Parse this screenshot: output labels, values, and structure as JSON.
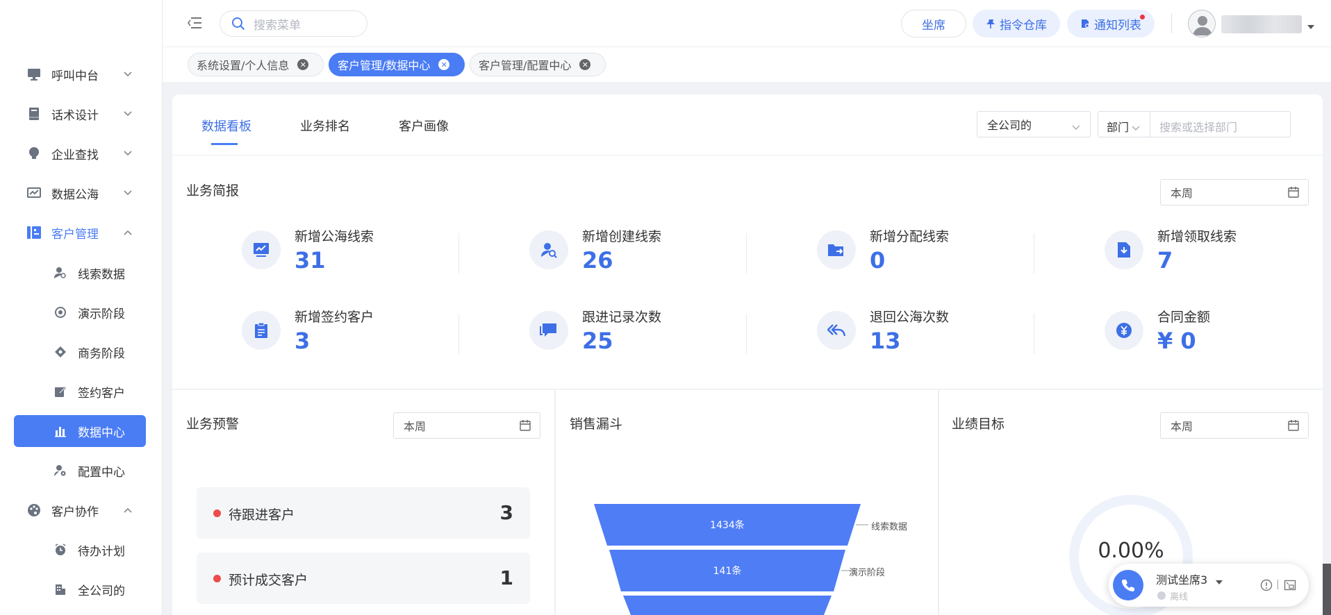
{
  "sidebar": {
    "items": [
      {
        "label": "呼叫中台",
        "icon": "monitor-icon",
        "chevron": "down"
      },
      {
        "label": "话术设计",
        "icon": "book-icon",
        "chevron": "down"
      },
      {
        "label": "企业查找",
        "icon": "lightbulb-icon",
        "chevron": "down"
      },
      {
        "label": "数据公海",
        "icon": "chart-screen-icon",
        "chevron": "down"
      },
      {
        "label": "客户管理",
        "icon": "customer-card-icon",
        "chevron": "up"
      },
      {
        "label": "线索数据",
        "icon": "user-search-icon"
      },
      {
        "label": "演示阶段",
        "icon": "target-icon"
      },
      {
        "label": "商务阶段",
        "icon": "diamond-icon"
      },
      {
        "label": "签约客户",
        "icon": "sign-icon"
      },
      {
        "label": "数据中心",
        "icon": "bar-chart-icon"
      },
      {
        "label": "配置中心",
        "icon": "user-gear-icon"
      },
      {
        "label": "客户协作",
        "icon": "palette-icon",
        "chevron": "up"
      },
      {
        "label": "待办计划",
        "icon": "alarm-icon"
      },
      {
        "label": "全公司的",
        "icon": "building-icon"
      }
    ]
  },
  "topbar": {
    "search_placeholder": "搜索菜单",
    "seat_label": "坐席",
    "command_label": "指令仓库",
    "notify_label": "通知列表"
  },
  "tags": [
    {
      "label": "系统设置/个人信息"
    },
    {
      "label": "客户管理/数据中心"
    },
    {
      "label": "客户管理/配置中心"
    }
  ],
  "tabs": [
    "数据看板",
    "业务排名",
    "客户画像"
  ],
  "filters": {
    "scope": "全公司的",
    "dept_label": "部门",
    "dept_placeholder": "搜索或选择部门"
  },
  "brief": {
    "title": "业务简报",
    "period": "本周",
    "stats": [
      {
        "label": "新增公海线索",
        "value": "31",
        "icon": "trend-screen-icon"
      },
      {
        "label": "新增创建线索",
        "value": "26",
        "icon": "user-search-icon"
      },
      {
        "label": "新增分配线索",
        "value": "0",
        "icon": "folder-share-icon"
      },
      {
        "label": "新增领取线索",
        "value": "7",
        "icon": "download-file-icon"
      },
      {
        "label": "新增签约客户",
        "value": "3",
        "icon": "clipboard-icon"
      },
      {
        "label": "跟进记录次数",
        "value": "25",
        "icon": "chat-icon"
      },
      {
        "label": "退回公海次数",
        "value": "13",
        "icon": "reply-all-icon"
      },
      {
        "label": "合同金额",
        "value": "¥ 0",
        "icon": "yen-coin-icon"
      }
    ]
  },
  "warning": {
    "title": "业务预警",
    "period": "本周",
    "rows": [
      {
        "label": "待跟进客户",
        "count": "3"
      },
      {
        "label": "预计成交客户",
        "count": "1"
      }
    ]
  },
  "funnel": {
    "title": "销售漏斗",
    "stages": [
      {
        "value": "1434条",
        "label": "线索数据"
      },
      {
        "value": "141条",
        "label": "演示阶段"
      }
    ]
  },
  "target": {
    "title": "业绩目标",
    "period": "本周",
    "percent": "0.00%",
    "progress": 0
  },
  "phone_widget": {
    "seat_name": "测试坐席3",
    "status": "离线"
  },
  "colors": {
    "accent": "#4a7cf4",
    "value_blue": "#3d6fe6",
    "warning_dot": "#ee4b4b"
  }
}
